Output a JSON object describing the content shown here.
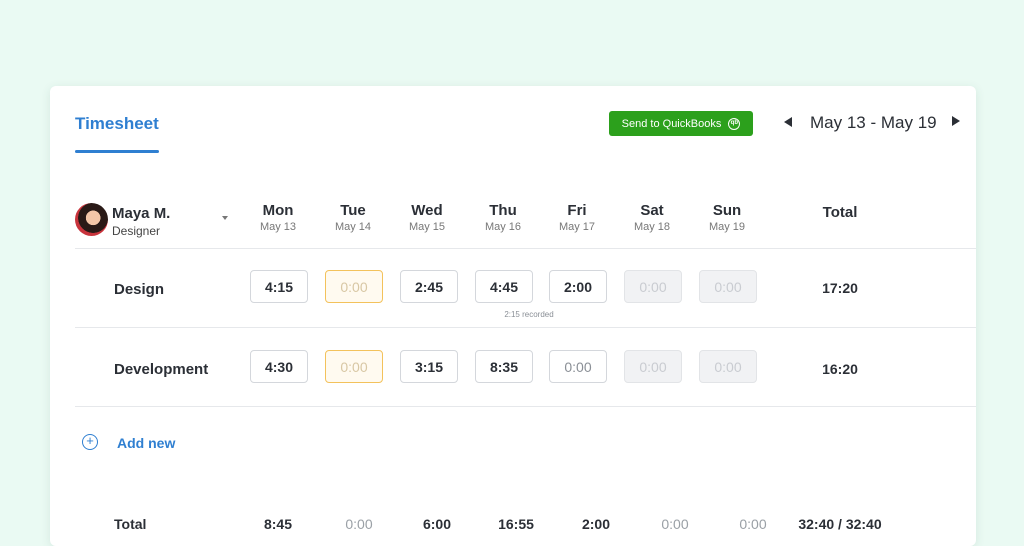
{
  "header": {
    "tab_label": "Timesheet",
    "quickbooks_button": "Send to QuickBooks",
    "quickbooks_logo": "qb",
    "date_range": "May 13 - May 19"
  },
  "user": {
    "name": "Maya M.",
    "role": "Designer"
  },
  "columns": {
    "days": [
      {
        "name": "Mon",
        "date": "May 13"
      },
      {
        "name": "Tue",
        "date": "May 14"
      },
      {
        "name": "Wed",
        "date": "May 15"
      },
      {
        "name": "Thu",
        "date": "May 16"
      },
      {
        "name": "Fri",
        "date": "May 17"
      },
      {
        "name": "Sat",
        "date": "May 18"
      },
      {
        "name": "Sun",
        "date": "May 19"
      }
    ],
    "total_label": "Total"
  },
  "rows": [
    {
      "label": "Design",
      "cells": [
        "4:15",
        "0:00",
        "2:45",
        "4:45",
        "2:00",
        "0:00",
        "0:00"
      ],
      "total": "17:20",
      "note": "2:15 recorded"
    },
    {
      "label": "Development",
      "cells": [
        "4:30",
        "0:00",
        "3:15",
        "8:35",
        "0:00",
        "0:00",
        "0:00"
      ],
      "total": "16:20"
    }
  ],
  "add_new_label": "Add new",
  "add_icon": "plus-circle-icon",
  "footer": {
    "label": "Total",
    "values": [
      "8:45",
      "0:00",
      "6:00",
      "16:55",
      "2:00",
      "0:00",
      "0:00"
    ],
    "grand_total": "32:40 / 32:40"
  },
  "colors": {
    "accent": "#2f7fd1",
    "quickbooks_green": "#2ca01c",
    "highlight_border": "#f3c25c",
    "background": "#eafaf3"
  }
}
